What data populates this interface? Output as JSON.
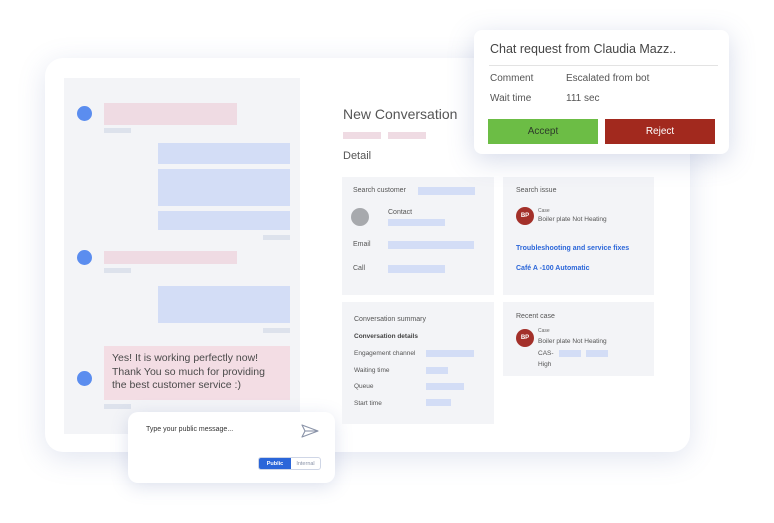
{
  "popup": {
    "title": "Chat request from Claudia Mazz..",
    "comment_label": "Comment",
    "comment_value": "Escalated from bot",
    "wait_label": "Wait time",
    "wait_value": "111 sec",
    "accept_label": "Accept",
    "reject_label": "Reject"
  },
  "conversation": {
    "title": "New Conversation",
    "detail_label": "Detail"
  },
  "chat": {
    "customer_message": "Yes! It is working perfectly now! Thank You so much for providing the best customer service :)"
  },
  "composer": {
    "placeholder": "Type your public message...",
    "public_label": "Public",
    "internal_label": "Internal"
  },
  "customer_card": {
    "search_label": "Search customer",
    "contact_label": "Contact",
    "email_label": "Email",
    "call_label": "Call"
  },
  "issue_card": {
    "search_label": "Search issue",
    "case_avatar": "BP",
    "case_tag": "Case",
    "case_title": "Boiler plate Not Heating",
    "link1": "Troubleshooting and service fixes",
    "link2": "Café A -100 Automatic"
  },
  "summary_card": {
    "title": "Conversation summary",
    "details_heading": "Conversation details",
    "engagement_label": "Engagement channel",
    "waiting_label": "Waiting time",
    "queue_label": "Queue",
    "start_label": "Start time"
  },
  "recent_card": {
    "title": "Recent case",
    "case_avatar": "BP",
    "case_tag": "Case",
    "case_title": "Boiler plate Not Heating",
    "cas_label": "CAS-",
    "priority": "High"
  },
  "colors": {
    "accept": "#6cbd45",
    "reject": "#a2291e",
    "accent": "#2b66d9",
    "avatar": "#a3302a"
  }
}
